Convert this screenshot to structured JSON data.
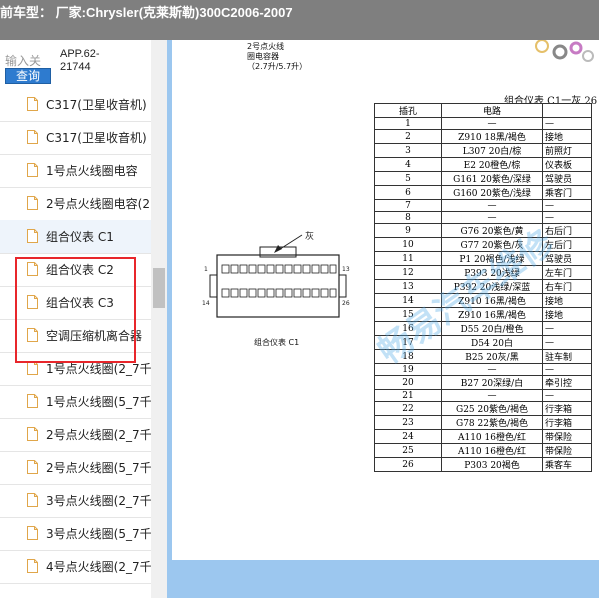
{
  "topbar": {
    "title": "前车型： 厂家:Chrysler(克莱斯勒)300C2006-2007"
  },
  "search": {
    "input_placeholder": "输入关",
    "button_label": "查询",
    "app_code_line1": "APP.62-",
    "app_code_line2": "21744"
  },
  "sidebar": {
    "items": [
      {
        "label": "C317(卫星收音机)"
      },
      {
        "label": "C317(卫星收音机)"
      },
      {
        "label": "1号点火线圈电容"
      },
      {
        "label": "2号点火线圈电容(2"
      },
      {
        "label": "组合仪表 C1"
      },
      {
        "label": "组合仪表 C2"
      },
      {
        "label": "组合仪表 C3"
      },
      {
        "label": "空调压缩机离合器"
      },
      {
        "label": "1号点火线圈(2_7千"
      },
      {
        "label": "1号点火线圈(5_7千"
      },
      {
        "label": "2号点火线圈(2_7千"
      },
      {
        "label": "2号点火线圈(5_7千"
      },
      {
        "label": "3号点火线圈(2_7千"
      },
      {
        "label": "3号点火线圈(5_7千"
      },
      {
        "label": "4号点火线圈(2_7千"
      }
    ]
  },
  "doc": {
    "caption_top_line1": "2号点火线",
    "caption_top_line2": "圈电容器",
    "caption_top_line3": "（2.7升/5.7升）",
    "connector_label": "灰",
    "connector_pin_left_top": "1",
    "connector_pin_right_top": "13",
    "connector_pin_left_bottom": "14",
    "connector_pin_right_bottom": "26",
    "connector_caption": "组合仪表 C1",
    "table_title": "组合仪表 C1一灰 26",
    "table_headers": [
      "插孔",
      "电路",
      ""
    ],
    "rows": [
      [
        "1",
        "—",
        "—"
      ],
      [
        "2",
        "Z910 18黑/褐色",
        "接地"
      ],
      [
        "3",
        "L307 20白/棕",
        "前照灯"
      ],
      [
        "4",
        "E2 20橙色/棕",
        "仪表板"
      ],
      [
        "5",
        "G161 20紫色/深绿",
        "驾驶员"
      ],
      [
        "6",
        "G160 20紫色/浅绿",
        "乘客门"
      ],
      [
        "7",
        "—",
        "—"
      ],
      [
        "8",
        "—",
        "—"
      ],
      [
        "9",
        "G76 20紫色/黄",
        "右后门"
      ],
      [
        "10",
        "G77 20紫色/灰",
        "左后门"
      ],
      [
        "11",
        "P1 20褐色/浅绿",
        "驾驶员"
      ],
      [
        "12",
        "P393 20浅绿",
        "左车门"
      ],
      [
        "13",
        "P392 20浅绿/深蓝",
        "右车门"
      ],
      [
        "14",
        "Z910 16黑/褐色",
        "接地"
      ],
      [
        "15",
        "Z910 16黑/褐色",
        "接地"
      ],
      [
        "16",
        "D55 20白/橙色",
        "—"
      ],
      [
        "17",
        "D54 20白",
        "—"
      ],
      [
        "18",
        "B25 20灰/黑",
        "驻车制"
      ],
      [
        "19",
        "—",
        "—"
      ],
      [
        "20",
        "B27 20深绿/白",
        "牵引控"
      ],
      [
        "21",
        "—",
        "—"
      ],
      [
        "22",
        "G25 20紫色/褐色",
        "行李箱"
      ],
      [
        "23",
        "G78 22紫色/褐色",
        "行李箱"
      ],
      [
        "24",
        "A110 16橙色/红",
        "带保险"
      ],
      [
        "25",
        "A110 16橙色/红",
        "带保险"
      ],
      [
        "26",
        "P303 20褐色",
        "乘客车"
      ]
    ],
    "watermark": "畅易汽车维修"
  },
  "colors": {
    "topbar": "#7f7f7f",
    "button": "#2e7bcf",
    "highlight": "#e8262b",
    "viewer_bg": "#9cc7ef"
  }
}
